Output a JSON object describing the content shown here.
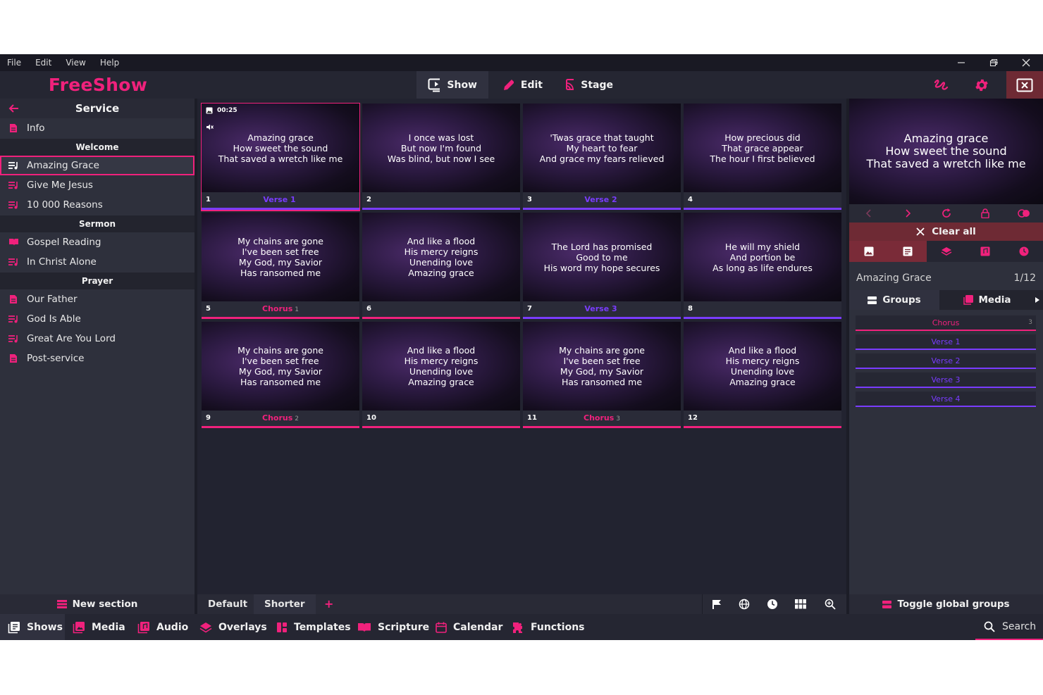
{
  "menu": [
    "File",
    "Edit",
    "View",
    "Help"
  ],
  "app_title": "FreeShow",
  "modes": [
    {
      "label": "Show",
      "icon": "show-icon"
    },
    {
      "label": "Edit",
      "icon": "pencil-icon"
    },
    {
      "label": "Stage",
      "icon": "cast-icon"
    }
  ],
  "colors": {
    "accent": "#f0217c",
    "verse": "#7a3cff",
    "chorus": "#f0217c"
  },
  "project": {
    "title": "Service",
    "items": [
      {
        "type": "item",
        "label": "Info",
        "icon": "document-icon"
      },
      {
        "type": "section",
        "label": "Welcome"
      },
      {
        "type": "item",
        "label": "Amazing Grace",
        "icon": "song-icon",
        "active": true
      },
      {
        "type": "item",
        "label": "Give Me Jesus",
        "icon": "song-icon"
      },
      {
        "type": "item",
        "label": "10 000 Reasons",
        "icon": "song-icon"
      },
      {
        "type": "section",
        "label": "Sermon"
      },
      {
        "type": "item",
        "label": "Gospel Reading",
        "icon": "book-icon"
      },
      {
        "type": "item",
        "label": "In Christ Alone",
        "icon": "song-icon"
      },
      {
        "type": "section",
        "label": "Prayer"
      },
      {
        "type": "item",
        "label": "Our Father",
        "icon": "document-icon"
      },
      {
        "type": "item",
        "label": "God Is Able",
        "icon": "song-icon"
      },
      {
        "type": "item",
        "label": "Great Are You Lord",
        "icon": "song-icon"
      },
      {
        "type": "item",
        "label": "Post-service",
        "icon": "document-icon"
      }
    ],
    "new_section": "New section"
  },
  "slides": [
    {
      "num": "1",
      "group": "Verse 1",
      "count": "",
      "kind": "verse",
      "lyrics": "Amazing grace\nHow sweet the sound\nThat saved a wretch like me",
      "timer": "00:25"
    },
    {
      "num": "2",
      "group": "",
      "count": "",
      "kind": "verse",
      "lyrics": "I once was lost\nBut now I'm found\nWas blind, but now I see"
    },
    {
      "num": "3",
      "group": "Verse 2",
      "count": "",
      "kind": "verse",
      "lyrics": "'Twas grace that taught\nMy heart to fear\nAnd grace my fears relieved"
    },
    {
      "num": "4",
      "group": "",
      "count": "",
      "kind": "verse",
      "lyrics": "How precious did\nThat grace appear\nThe hour I first believed"
    },
    {
      "num": "5",
      "group": "Chorus",
      "count": "1",
      "kind": "chorus",
      "lyrics": "My chains are gone\nI've been set free\nMy God, my Savior\nHas ransomed me"
    },
    {
      "num": "6",
      "group": "",
      "count": "",
      "kind": "chorus",
      "lyrics": "And like a flood\nHis mercy reigns\nUnending love\nAmazing grace"
    },
    {
      "num": "7",
      "group": "Verse 3",
      "count": "",
      "kind": "verse",
      "lyrics": "The Lord has promised\nGood to me\nHis word my hope secures"
    },
    {
      "num": "8",
      "group": "",
      "count": "",
      "kind": "verse",
      "lyrics": "He will my shield\nAnd portion be\nAs long as life endures"
    },
    {
      "num": "9",
      "group": "Chorus",
      "count": "2",
      "kind": "chorus",
      "lyrics": "My chains are gone\nI've been set free\nMy God, my Savior\nHas ransomed me"
    },
    {
      "num": "10",
      "group": "",
      "count": "",
      "kind": "chorus",
      "lyrics": "And like a flood\nHis mercy reigns\nUnending love\nAmazing grace"
    },
    {
      "num": "11",
      "group": "Chorus",
      "count": "3",
      "kind": "chorus",
      "lyrics": "My chains are gone\nI've been set free\nMy God, my Savior\nHas ransomed me"
    },
    {
      "num": "12",
      "group": "",
      "count": "",
      "kind": "chorus",
      "lyrics": "And like a flood\nHis mercy reigns\nUnending love\nAmazing grace"
    }
  ],
  "layouts": {
    "tabs": [
      "Default",
      "Shorter"
    ],
    "add": "+"
  },
  "preview": {
    "lyrics": "Amazing grace\nHow sweet the sound\nThat saved a wretch like me",
    "clear_all": "Clear all",
    "show_name": "Amazing Grace",
    "position": "1/12"
  },
  "right_tabs": {
    "groups": "Groups",
    "media": "Media"
  },
  "groups": [
    {
      "label": "Chorus",
      "count": "3",
      "kind": "chorus"
    },
    {
      "label": "Verse 1",
      "count": "",
      "kind": "verse"
    },
    {
      "label": "Verse 2",
      "count": "",
      "kind": "verse"
    },
    {
      "label": "Verse 3",
      "count": "",
      "kind": "verse"
    },
    {
      "label": "Verse 4",
      "count": "",
      "kind": "verse"
    }
  ],
  "toggle_global": "Toggle global groups",
  "drawer": [
    {
      "label": "Shows",
      "icon": "shows-icon"
    },
    {
      "label": "Media",
      "icon": "media-icon"
    },
    {
      "label": "Audio",
      "icon": "audio-icon"
    },
    {
      "label": "Overlays",
      "icon": "overlays-icon"
    },
    {
      "label": "Templates",
      "icon": "templates-icon"
    },
    {
      "label": "Scripture",
      "icon": "scripture-icon"
    },
    {
      "label": "Calendar",
      "icon": "calendar-icon"
    },
    {
      "label": "Functions",
      "icon": "functions-icon"
    }
  ],
  "search_label": "Search"
}
